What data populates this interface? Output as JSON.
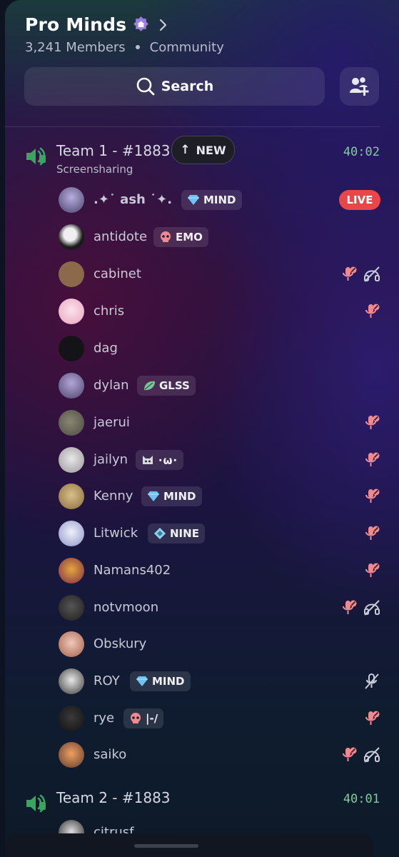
{
  "server": {
    "name": "Pro Minds",
    "members": "3,241 Members",
    "type": "Community",
    "badge_icon": "home-badge-icon",
    "accent": "#9d7ce0"
  },
  "search": {
    "label": "Search"
  },
  "add_member_icon": "add-member-icon",
  "channels": [
    {
      "name": "Team 1 - #1883",
      "subtitle": "Screensharing",
      "time": "40:02",
      "new_label": "NEW",
      "members": [
        {
          "name": ".✦˙ ash ˙✦.",
          "tag": "MIND",
          "tag_icon": "gem-icon",
          "status": "LIVE",
          "mic_off": false,
          "deafened": false
        },
        {
          "name": "antidote",
          "tag": "EMO",
          "tag_icon": "skull-icon",
          "mic_off": false,
          "deafened": false
        },
        {
          "name": "cabinet",
          "mic_off": true,
          "deafened": true
        },
        {
          "name": "chris",
          "mic_off": true,
          "deafened": false
        },
        {
          "name": "dag",
          "mic_off": false,
          "deafened": false
        },
        {
          "name": "dylan",
          "tag": "GLSS",
          "tag_icon": "leaf-icon",
          "mic_off": false,
          "deafened": false
        },
        {
          "name": "jaerui",
          "mic_off": true,
          "deafened": false
        },
        {
          "name": "jailyn",
          "tag": "･ω･",
          "tag_icon": "cat-icon",
          "mic_off": true,
          "deafened": false
        },
        {
          "name": "Kenny",
          "tag": "MIND",
          "tag_icon": "gem-icon",
          "mic_off": true,
          "deafened": false
        },
        {
          "name": "Litwick",
          "tag": "NINE",
          "tag_icon": "diamond-icon",
          "mic_off": true,
          "deafened": false
        },
        {
          "name": "Namans402",
          "mic_off": true,
          "deafened": false
        },
        {
          "name": "notvmoon",
          "mic_off": true,
          "deafened": true
        },
        {
          "name": "Obskury",
          "mic_off": false,
          "deafened": false
        },
        {
          "name": "ROY",
          "tag": "MIND",
          "tag_icon": "gem-icon",
          "server_muted": true,
          "mic_off": false,
          "deafened": false
        },
        {
          "name": "rye",
          "tag": "|-/",
          "tag_icon": "skull-icon",
          "mic_off": true,
          "deafened": false
        },
        {
          "name": "saiko",
          "mic_off": true,
          "deafened": true
        }
      ]
    },
    {
      "name": "Team 2 - #1883",
      "time": "40:01",
      "members": [
        {
          "name": "citrusf"
        }
      ]
    }
  ],
  "colors": {
    "voice_green": "#3ba55d",
    "live_red": "#e8474a",
    "muted_red": "#f08a8f",
    "time_green": "#7fcf9a"
  }
}
